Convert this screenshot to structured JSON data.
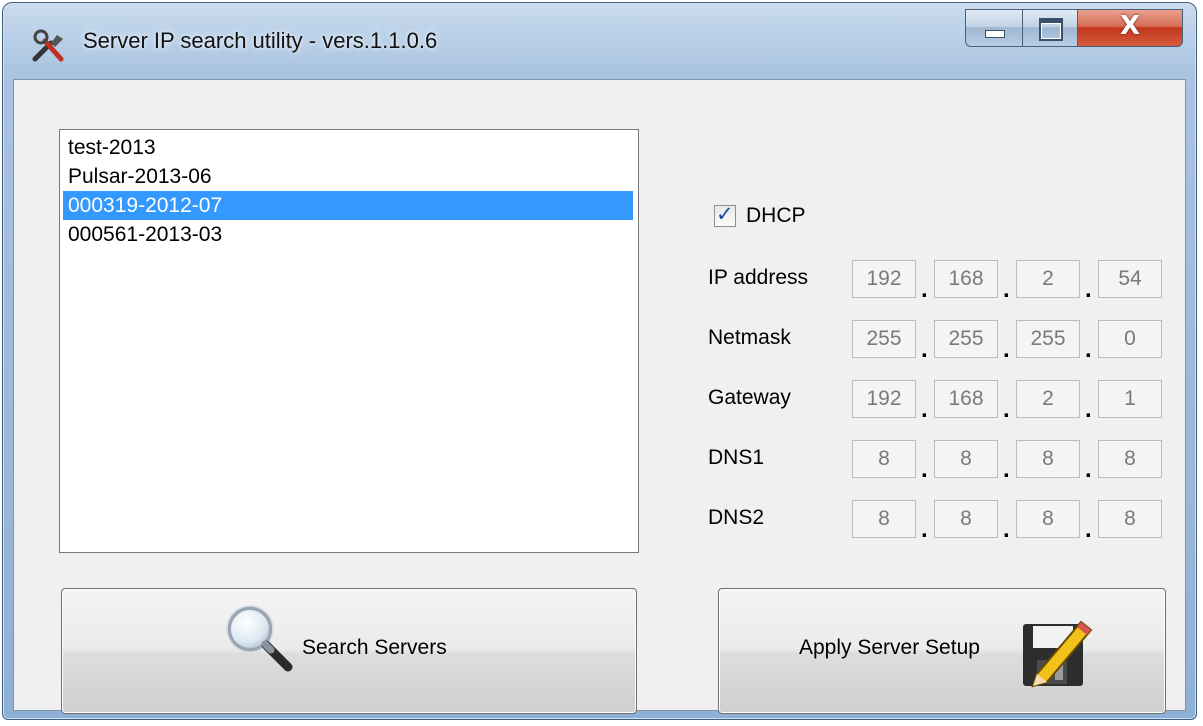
{
  "window": {
    "title": "Server IP search utility - vers.1.1.0.6",
    "close_glyph": "X",
    "icons": {
      "app": "tools-icon",
      "minimize": "minimize-icon",
      "maximize": "maximize-icon",
      "close": "close-icon"
    }
  },
  "servers": {
    "items": [
      "test-2013",
      "Pulsar-2013-06",
      "000319-2012-07",
      "000561-2013-03"
    ],
    "selected_index": 2
  },
  "dhcp": {
    "label": "DHCP",
    "checked": true
  },
  "network": {
    "ip": {
      "label": "IP address",
      "octets": [
        "192",
        "168",
        "2",
        "54"
      ]
    },
    "netmask": {
      "label": "Netmask",
      "octets": [
        "255",
        "255",
        "255",
        "0"
      ]
    },
    "gateway": {
      "label": "Gateway",
      "octets": [
        "192",
        "168",
        "2",
        "1"
      ]
    },
    "dns1": {
      "label": "DNS1",
      "octets": [
        "8",
        "8",
        "8",
        "8"
      ]
    },
    "dns2": {
      "label": "DNS2",
      "octets": [
        "8",
        "8",
        "8",
        "8"
      ]
    }
  },
  "buttons": {
    "search": {
      "label": "Search Servers",
      "icon": "magnifier-icon"
    },
    "apply": {
      "label": "Apply Server Setup",
      "icon": "save-edit-icon"
    }
  },
  "colors": {
    "selection": "#3399ff",
    "client_bg": "#f0f0f0",
    "close_button": "#c3371c"
  }
}
